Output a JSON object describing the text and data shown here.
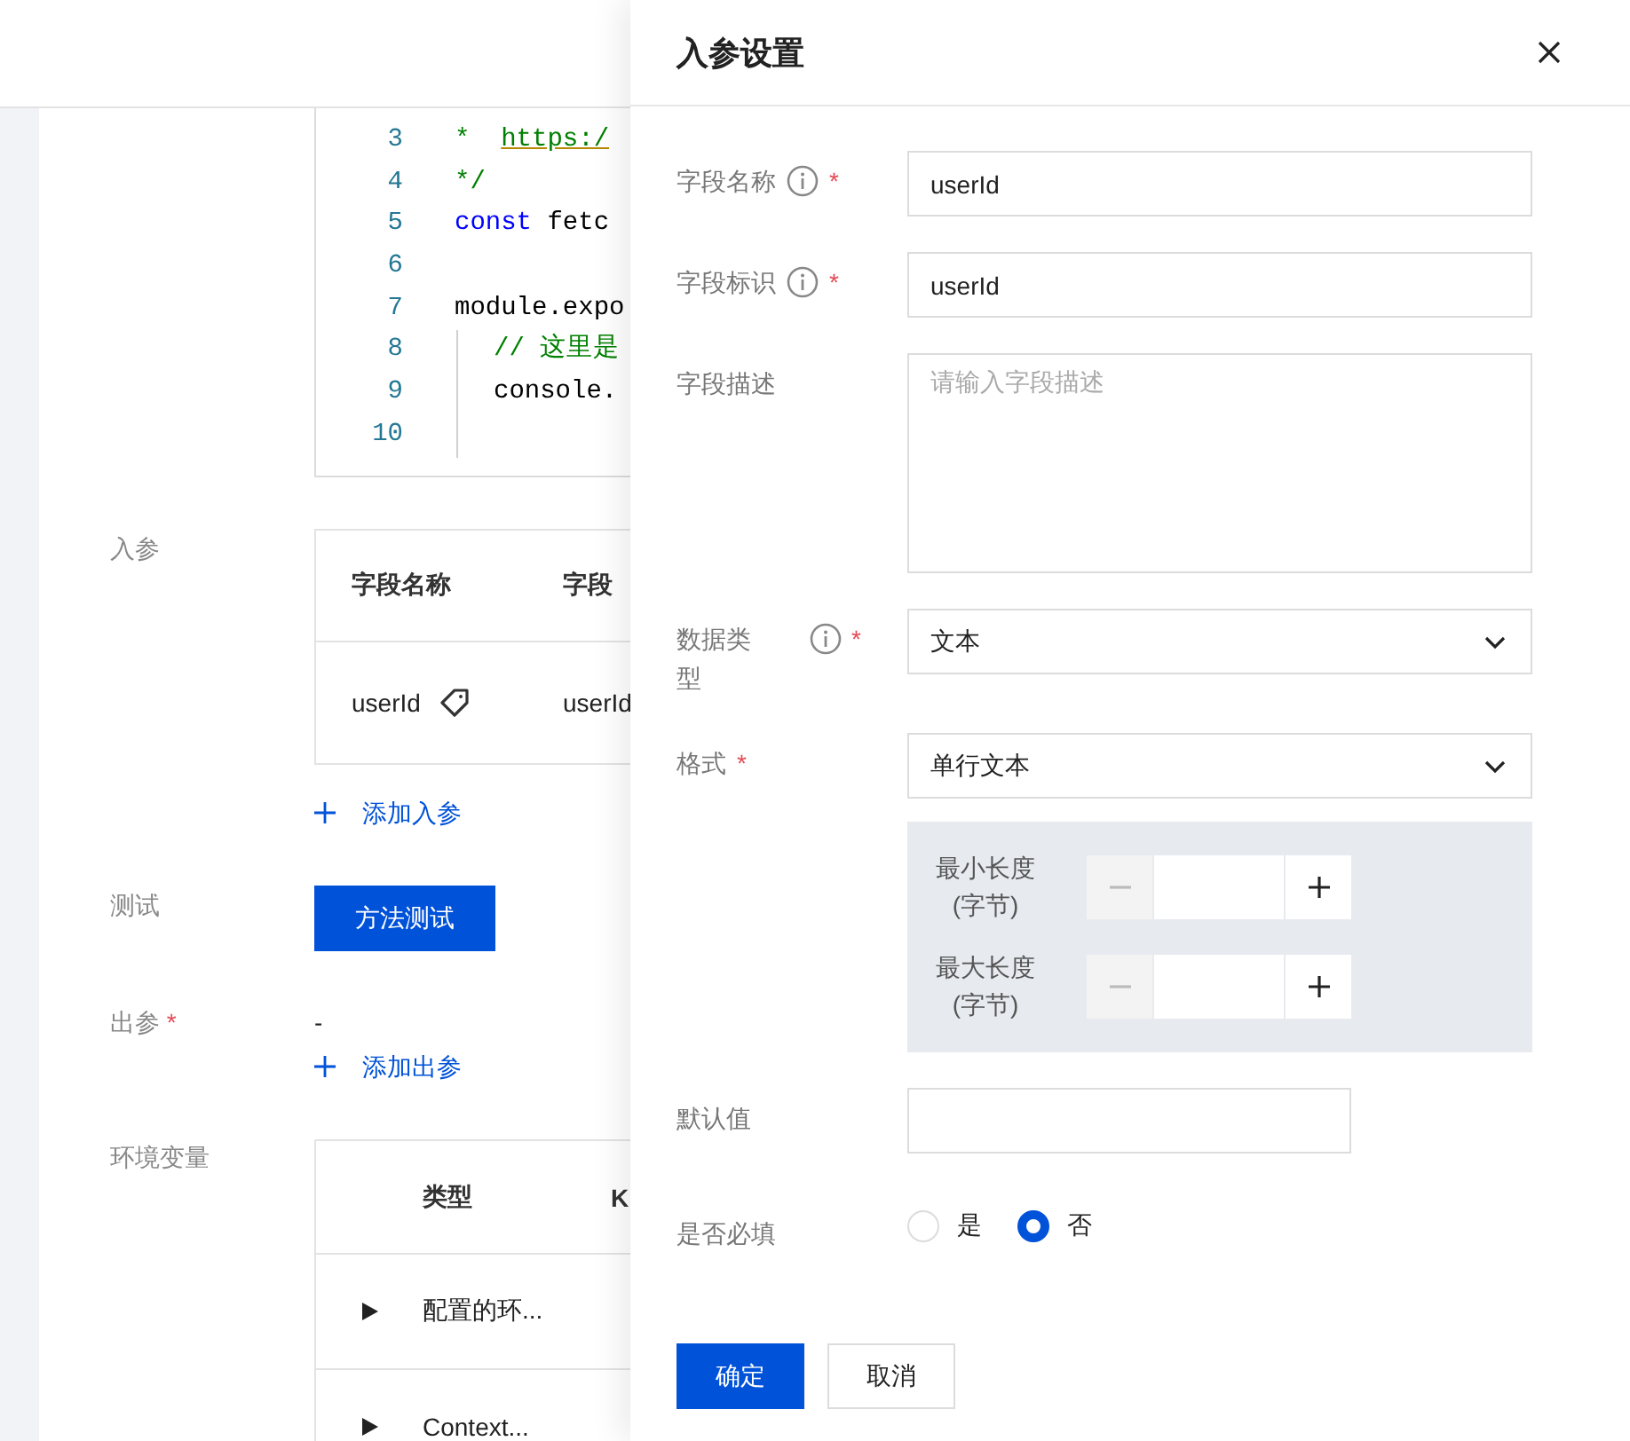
{
  "code_editor": {
    "lines": [
      {
        "number": "3",
        "tokens": [
          {
            "text": "*  ",
            "kind": "comment"
          },
          {
            "text": "https:/",
            "kind": "link"
          }
        ]
      },
      {
        "number": "4",
        "tokens": [
          {
            "text": "*/",
            "kind": "comment"
          }
        ]
      },
      {
        "number": "5",
        "tokens": [
          {
            "text": "const",
            "kind": "keyword"
          },
          {
            "text": " fetc",
            "kind": "plain"
          }
        ]
      },
      {
        "number": "6"
      },
      {
        "number": "7",
        "tokens": [
          {
            "text": "module.expo",
            "kind": "plain"
          }
        ]
      },
      {
        "number": "8",
        "indent": true,
        "tokens": [
          {
            "text": "// 这里是",
            "kind": "comment"
          }
        ]
      },
      {
        "number": "9",
        "indent": true,
        "tokens": [
          {
            "text": "console.",
            "kind": "plain"
          }
        ]
      },
      {
        "number": "10",
        "indent": true
      }
    ]
  },
  "input_params": {
    "label": "入参",
    "columns": [
      "字段名称",
      "字段"
    ],
    "rows": [
      {
        "tagged": true,
        "cells": [
          "userId",
          "userId"
        ]
      }
    ],
    "add_link": "添加入参"
  },
  "test": {
    "label": "测试",
    "button": "方法测试"
  },
  "output_params": {
    "label": "出参",
    "required": true,
    "value": "-",
    "add_link": "添加出参"
  },
  "env_vars": {
    "label": "环境变量",
    "columns": [
      "类型",
      "K"
    ],
    "rows": [
      {
        "expanded": false,
        "cells": [
          "配置的环..."
        ]
      },
      {
        "expanded": false,
        "cells": [
          "Context..."
        ]
      }
    ]
  },
  "drawer": {
    "title": "入参设置",
    "fields": [
      {
        "kind": "input",
        "label": "字段名称",
        "info": true,
        "required": true,
        "value": "userId"
      },
      {
        "kind": "input",
        "label": "字段标识",
        "info": true,
        "required": true,
        "value": "userId"
      },
      {
        "kind": "textarea",
        "label": "字段描述",
        "placeholder": "请输入字段描述"
      },
      {
        "kind": "select",
        "label": "数据类型",
        "info": true,
        "required": true,
        "value": "文本"
      },
      {
        "kind": "select",
        "label": "格式",
        "required": true,
        "value": "单行文本"
      },
      {
        "kind": "range",
        "steppers": [
          {
            "label": "最小长度(字节)",
            "minus_disabled": true
          },
          {
            "label": "最大长度(字节)",
            "minus_disabled": true
          }
        ]
      },
      {
        "kind": "short_input",
        "label": "默认值"
      },
      {
        "kind": "radio",
        "label": "是否必填",
        "options": [
          {
            "label": "是",
            "selected": false
          },
          {
            "label": "否",
            "selected": true
          }
        ]
      }
    ],
    "buttons": [
      {
        "label": "确定",
        "primary": true
      },
      {
        "label": "取消",
        "primary": false
      }
    ]
  }
}
